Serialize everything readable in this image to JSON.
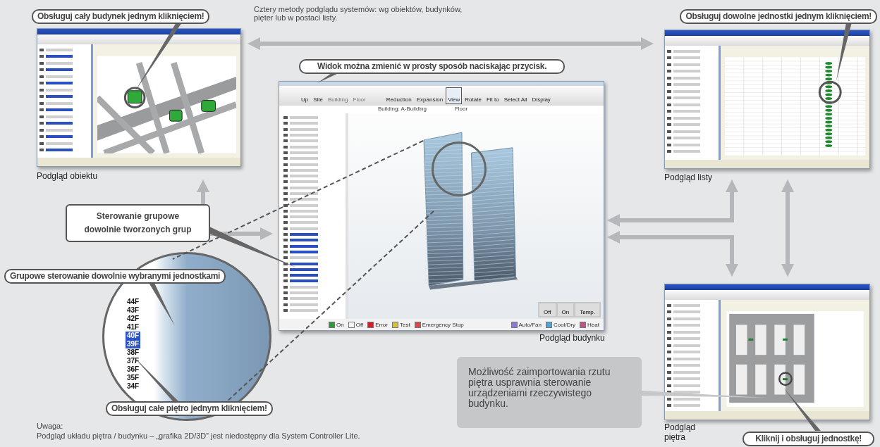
{
  "intro_text": "Cztery metody podglądu systemów: wg obiektów, budynków, pięter lub w postaci listy.",
  "callouts": [
    {
      "kind": "pill",
      "text": "Obsługuj cały budynek jednym kliknięciem!"
    },
    {
      "kind": "pill",
      "text": "Widok można zmienić w prosty sposób naciskając przycisk."
    },
    {
      "kind": "pill",
      "text": "Obsługuj dowolne jednostki jednym kliknięciem!"
    },
    {
      "kind": "box",
      "text": "Sterowanie grupowe dowolnie tworzonych grup"
    },
    {
      "kind": "pill",
      "text": "Grupowe sterowanie dowolnie wybranymi jednostkami"
    },
    {
      "kind": "pill",
      "text": "Obsługuj całe piętro jednym kliknięciem!"
    },
    {
      "kind": "pill",
      "text": "Kliknij i obsługuj jednostkę!"
    }
  ],
  "views": [
    {
      "kind": "site",
      "caption": "Podgląd obiektu"
    },
    {
      "kind": "list",
      "caption": "Podgląd listy"
    },
    {
      "kind": "building",
      "caption": "Podgląd budynku",
      "toolbar": [
        {
          "label": "Up",
          "selected": false,
          "disabled": false
        },
        {
          "label": "Site",
          "selected": false,
          "disabled": false
        },
        {
          "label": "Building",
          "selected": false,
          "disabled": true
        },
        {
          "label": "Floor",
          "selected": false,
          "disabled": true
        },
        {
          "label": "Reduction",
          "selected": false,
          "disabled": false
        },
        {
          "label": "Expansion",
          "selected": false,
          "disabled": false
        },
        {
          "label": "View",
          "selected": true,
          "disabled": false
        },
        {
          "label": "Rotate",
          "selected": false,
          "disabled": false
        },
        {
          "label": "Fit to",
          "selected": false,
          "disabled": false
        },
        {
          "label": "Select All",
          "selected": false,
          "disabled": false
        },
        {
          "label": "Display",
          "selected": false,
          "disabled": false
        }
      ],
      "info": [
        "Building: A-Building",
        "Floor"
      ],
      "legend": [
        {
          "label": "On",
          "color": "#2a9d3a"
        },
        {
          "label": "Off",
          "color": "#f4f4f4"
        },
        {
          "label": "Error",
          "color": "#d0202a"
        },
        {
          "label": "Test",
          "color": "#d8c030"
        },
        {
          "label": "Emergency Stop",
          "color": "#e04848"
        }
      ],
      "modes": [
        {
          "label": "Auto/Fan",
          "color": "#8a7bd0"
        },
        {
          "label": "Cool/Dry",
          "color": "#4aa8dc"
        },
        {
          "label": "Heat",
          "color": "#c8508a"
        }
      ],
      "buttons": [
        "Off",
        "On",
        "Temp."
      ]
    },
    {
      "kind": "floor",
      "caption": "Podgląd piętra"
    }
  ],
  "magnifier": {
    "floors": [
      {
        "label": "44F",
        "selected": false
      },
      {
        "label": "43F",
        "selected": false
      },
      {
        "label": "42F",
        "selected": false
      },
      {
        "label": "41F",
        "selected": false
      },
      {
        "label": "40F",
        "selected": true
      },
      {
        "label": "39F",
        "selected": true
      },
      {
        "label": "38F",
        "selected": false
      },
      {
        "label": "37F",
        "selected": false
      },
      {
        "label": "36F",
        "selected": false
      },
      {
        "label": "35F",
        "selected": false
      },
      {
        "label": "34F",
        "selected": false
      }
    ]
  },
  "note_box": "Możliwość zaimportowania rzutu piętra usprawnia sterowanie urządzeniami rzeczywistego budynku.",
  "note": {
    "heading": "Uwaga:",
    "text": "Podgląd układu piętra / budynku – „grafika 2D/3D” jest niedostępny dla System Controller Lite."
  }
}
